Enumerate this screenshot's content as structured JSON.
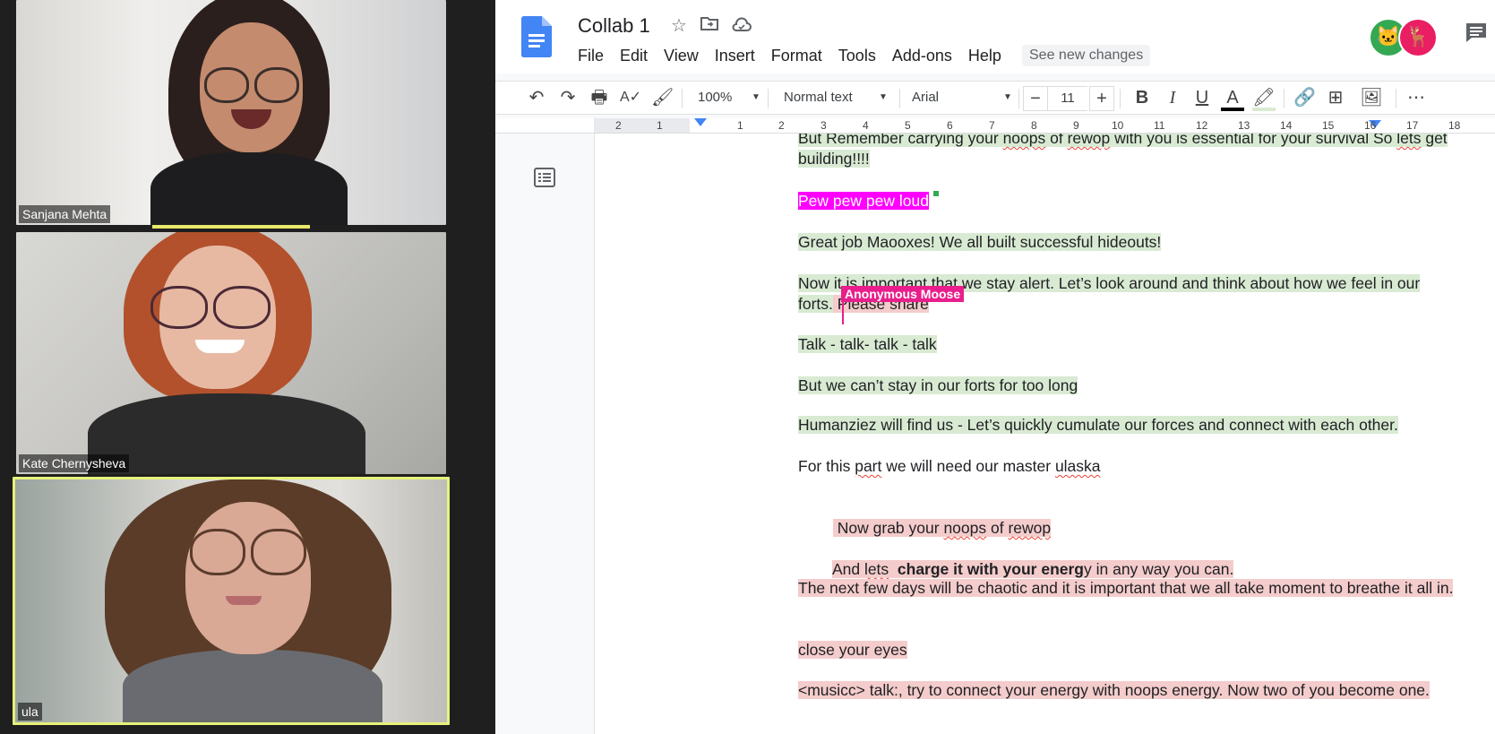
{
  "video_call": {
    "participants": [
      {
        "name": "Sanjana Mehta"
      },
      {
        "name": "Kate Chernysheva"
      },
      {
        "name": "ula"
      }
    ]
  },
  "docs": {
    "title": "Collab 1",
    "menu": [
      "File",
      "Edit",
      "View",
      "Insert",
      "Format",
      "Tools",
      "Add-ons",
      "Help"
    ],
    "see_new_changes": "See new changes",
    "avatars": [
      {
        "icon": "cat-avatar-icon",
        "color": "#34a853"
      },
      {
        "icon": "moose-avatar-icon",
        "color": "#e91e63"
      }
    ],
    "toolbar": {
      "zoom": "100%",
      "style": "Normal text",
      "font": "Arial",
      "font_size": "11",
      "minus": "−",
      "plus": "+",
      "bold": "B",
      "italic": "I",
      "underline": "U",
      "text_color": "A"
    },
    "ruler": [
      "2",
      "1",
      "1",
      "2",
      "3",
      "4",
      "5",
      "6",
      "7",
      "8",
      "9",
      "10",
      "11",
      "12",
      "13",
      "14",
      "15",
      "16",
      "17",
      "18"
    ],
    "collaborator_cursor": "Anonymous Moose",
    "content": {
      "p1_a": "But Remember carrying your ",
      "p1_b": "noops",
      "p1_c": " of ",
      "p1_d": "rewop",
      "p1_e": " with you is essential for your survival So ",
      "p1_f": "lets",
      "p1_g": " get building!!!!",
      "p2": "Pew pew pew loud",
      "p3": "Great job Maooxes! We all built successful hideouts!",
      "p4_a": "Now it is important that we stay alert. Let’s look around and think about how we feel in our forts.",
      "p4_b": " Please share",
      "p5": "Talk - talk- talk - talk",
      "p6": "But we can’t stay in our forts for too long",
      "p7": "Humanziez will find us - Let’s quickly cumulate our forces and connect with each other.",
      "p8_a": "For this ",
      "p8_b": "part",
      "p8_c": " we will need our master ",
      "p8_d": "ulaska",
      "p9_a": " Now grab your ",
      "p9_b": "noops",
      "p9_c": " of ",
      "p9_d": "rewop",
      "p10_a": "And ",
      "p10_b": "lets",
      "p10_c": "  charge it with your energ",
      "p10_d": "y in any way you can.",
      "p11": "The next few days will be chaotic and it is important that we all take moment to breathe it all in.",
      "p12": "close your eyes",
      "p13": "<musicc> talk:, try to connect your energy with noops energy. Now two of you become one."
    }
  }
}
